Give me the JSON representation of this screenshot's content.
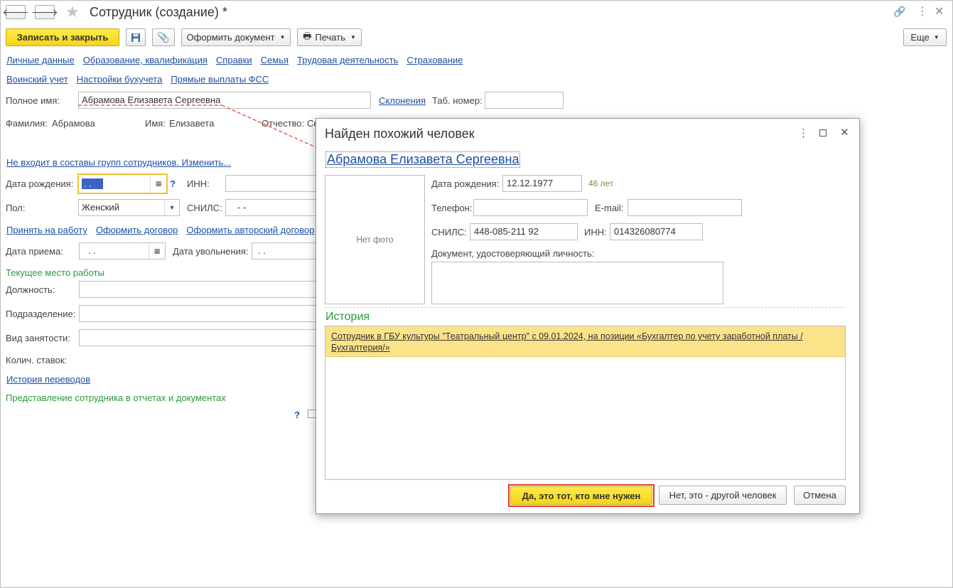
{
  "window": {
    "title": "Сотрудник (создание) *"
  },
  "toolbar": {
    "save_close": "Записать и закрыть",
    "create_document": "Оформить документ",
    "print": "Печать",
    "more": "Еще"
  },
  "tabs_row1": [
    "Личные данные",
    "Образование, квалификация",
    "Справки",
    "Семья",
    "Трудовая деятельность",
    "Страхование"
  ],
  "tabs_row2": [
    "Воинский учет",
    "Настройки бухучета",
    "Прямые выплаты ФСС"
  ],
  "form": {
    "full_name_label": "Полное имя:",
    "full_name_value": "Абрамова Елизавета Сергеевна",
    "declension_link": "Склонения",
    "tab_number_label": "Таб. номер:",
    "surname_label": "Фамилия:",
    "surname_value": "Абрамова",
    "name_label": "Имя:",
    "name_value": "Елизавета",
    "patronymic_label": "Отчество:",
    "patronymic_value": "Се",
    "groups_link": "Не входит в составы групп сотрудников. Изменить...",
    "birth_label": "Дата рождения:",
    "birth_value": " .  .",
    "help_mark": "?",
    "inn_label": "ИНН:",
    "gender_label": "Пол:",
    "gender_value": "Женский",
    "snils_label": "СНИЛС:",
    "snils_value": "-   -",
    "hire_link": "Принять на работу",
    "contract_link": "Оформить договор",
    "author_contract_link": "Оформить авторский договор",
    "hire_date_label": "Дата приема:",
    "hire_date_value": " .  .",
    "dismiss_date_label": "Дата увольнения:",
    "dismiss_date_value": " .  .",
    "current_job_header": "Текущее место работы",
    "position_label": "Должность:",
    "department_label": "Подразделение:",
    "employment_type_label": "Вид занятости:",
    "rates_label": "Колич. ставок:",
    "transfers_link": "История переводов",
    "representation_header": "Представление сотрудника в отчетах и документах",
    "help_mark2": "?"
  },
  "dialog": {
    "title": "Найден похожий человек",
    "person_link": "Абрамова Елизавета Сергеевна",
    "no_photo": "Нет фото",
    "birth_label": "Дата рождения:",
    "birth_value": "12.12.1977",
    "age": "46 лет",
    "phone_label": "Телефон:",
    "email_label": "E-mail:",
    "snils_label": "СНИЛС:",
    "snils_value": "448-085-211 92",
    "inn_label": "ИНН:",
    "inn_value": "014326080774",
    "id_doc_label": "Документ, удостоверяющий личность:",
    "history_header": "История",
    "history_item": "Сотрудник в ГБУ культуры \"Театральный центр\" с 09.01.2024, на позиции «Бухгалтер по учету заработной платы /Бухгалтерия/»",
    "btn_yes": "Да, это тот, кто мне нужен",
    "btn_no": "Нет, это - другой человек",
    "btn_cancel": "Отмена"
  },
  "colors": {
    "accent_yellow": "#f4d41b",
    "link": "#1f4fa4",
    "green_header": "#2a9a3c",
    "highlight_red": "#e53935"
  }
}
